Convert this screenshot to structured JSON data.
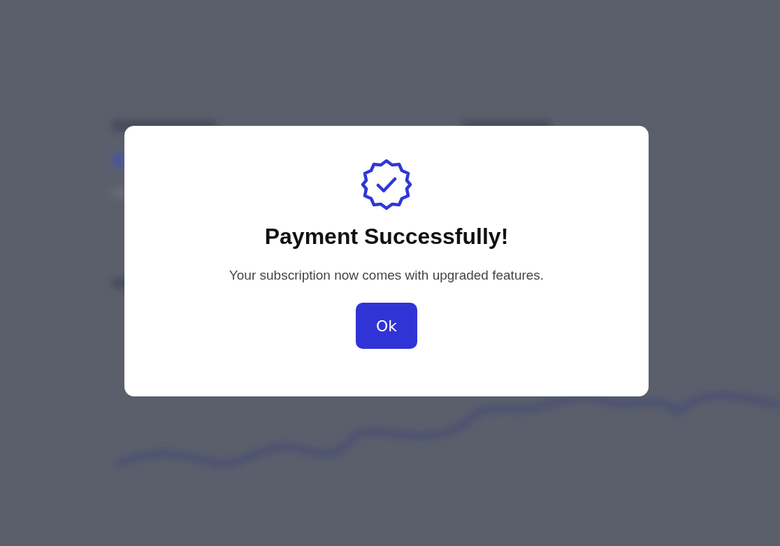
{
  "dialog": {
    "title": "Payment Successfully!",
    "message": "Your subscription now comes with upgraded features.",
    "buttons": [
      {
        "label": "Ok",
        "kind": "primary"
      }
    ]
  }
}
